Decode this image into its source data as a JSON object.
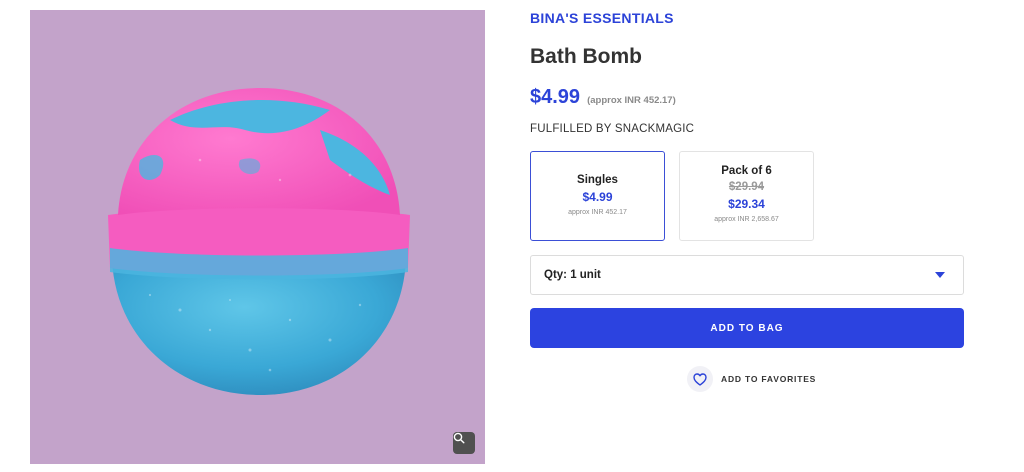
{
  "brand": {
    "name": "BINA'S ESSENTIALS"
  },
  "product": {
    "title": "Bath Bomb",
    "price": "$4.99",
    "approx": "(approx INR 452.17)",
    "fulfilled": "FULFILLED BY SNACKMAGIC"
  },
  "variants": [
    {
      "name": "Singles",
      "price": "$4.99",
      "approx": "approx INR 452.17",
      "selected": true
    },
    {
      "name": "Pack of 6",
      "old_price": "$29.94",
      "price": "$29.34",
      "approx": "approx INR 2,658.67",
      "selected": false
    }
  ],
  "quantity": {
    "label": "Qty: 1 unit"
  },
  "actions": {
    "add_to_bag": "ADD TO BAG",
    "add_to_favorites": "ADD TO FAVORITES"
  },
  "icons": {
    "zoom": "zoom-search-icon",
    "caret": "caret-down-icon",
    "heart": "heart-icon"
  },
  "colors": {
    "accent": "#2c43d8",
    "button": "#2c43e0",
    "image_background": "#c3a3ca"
  }
}
